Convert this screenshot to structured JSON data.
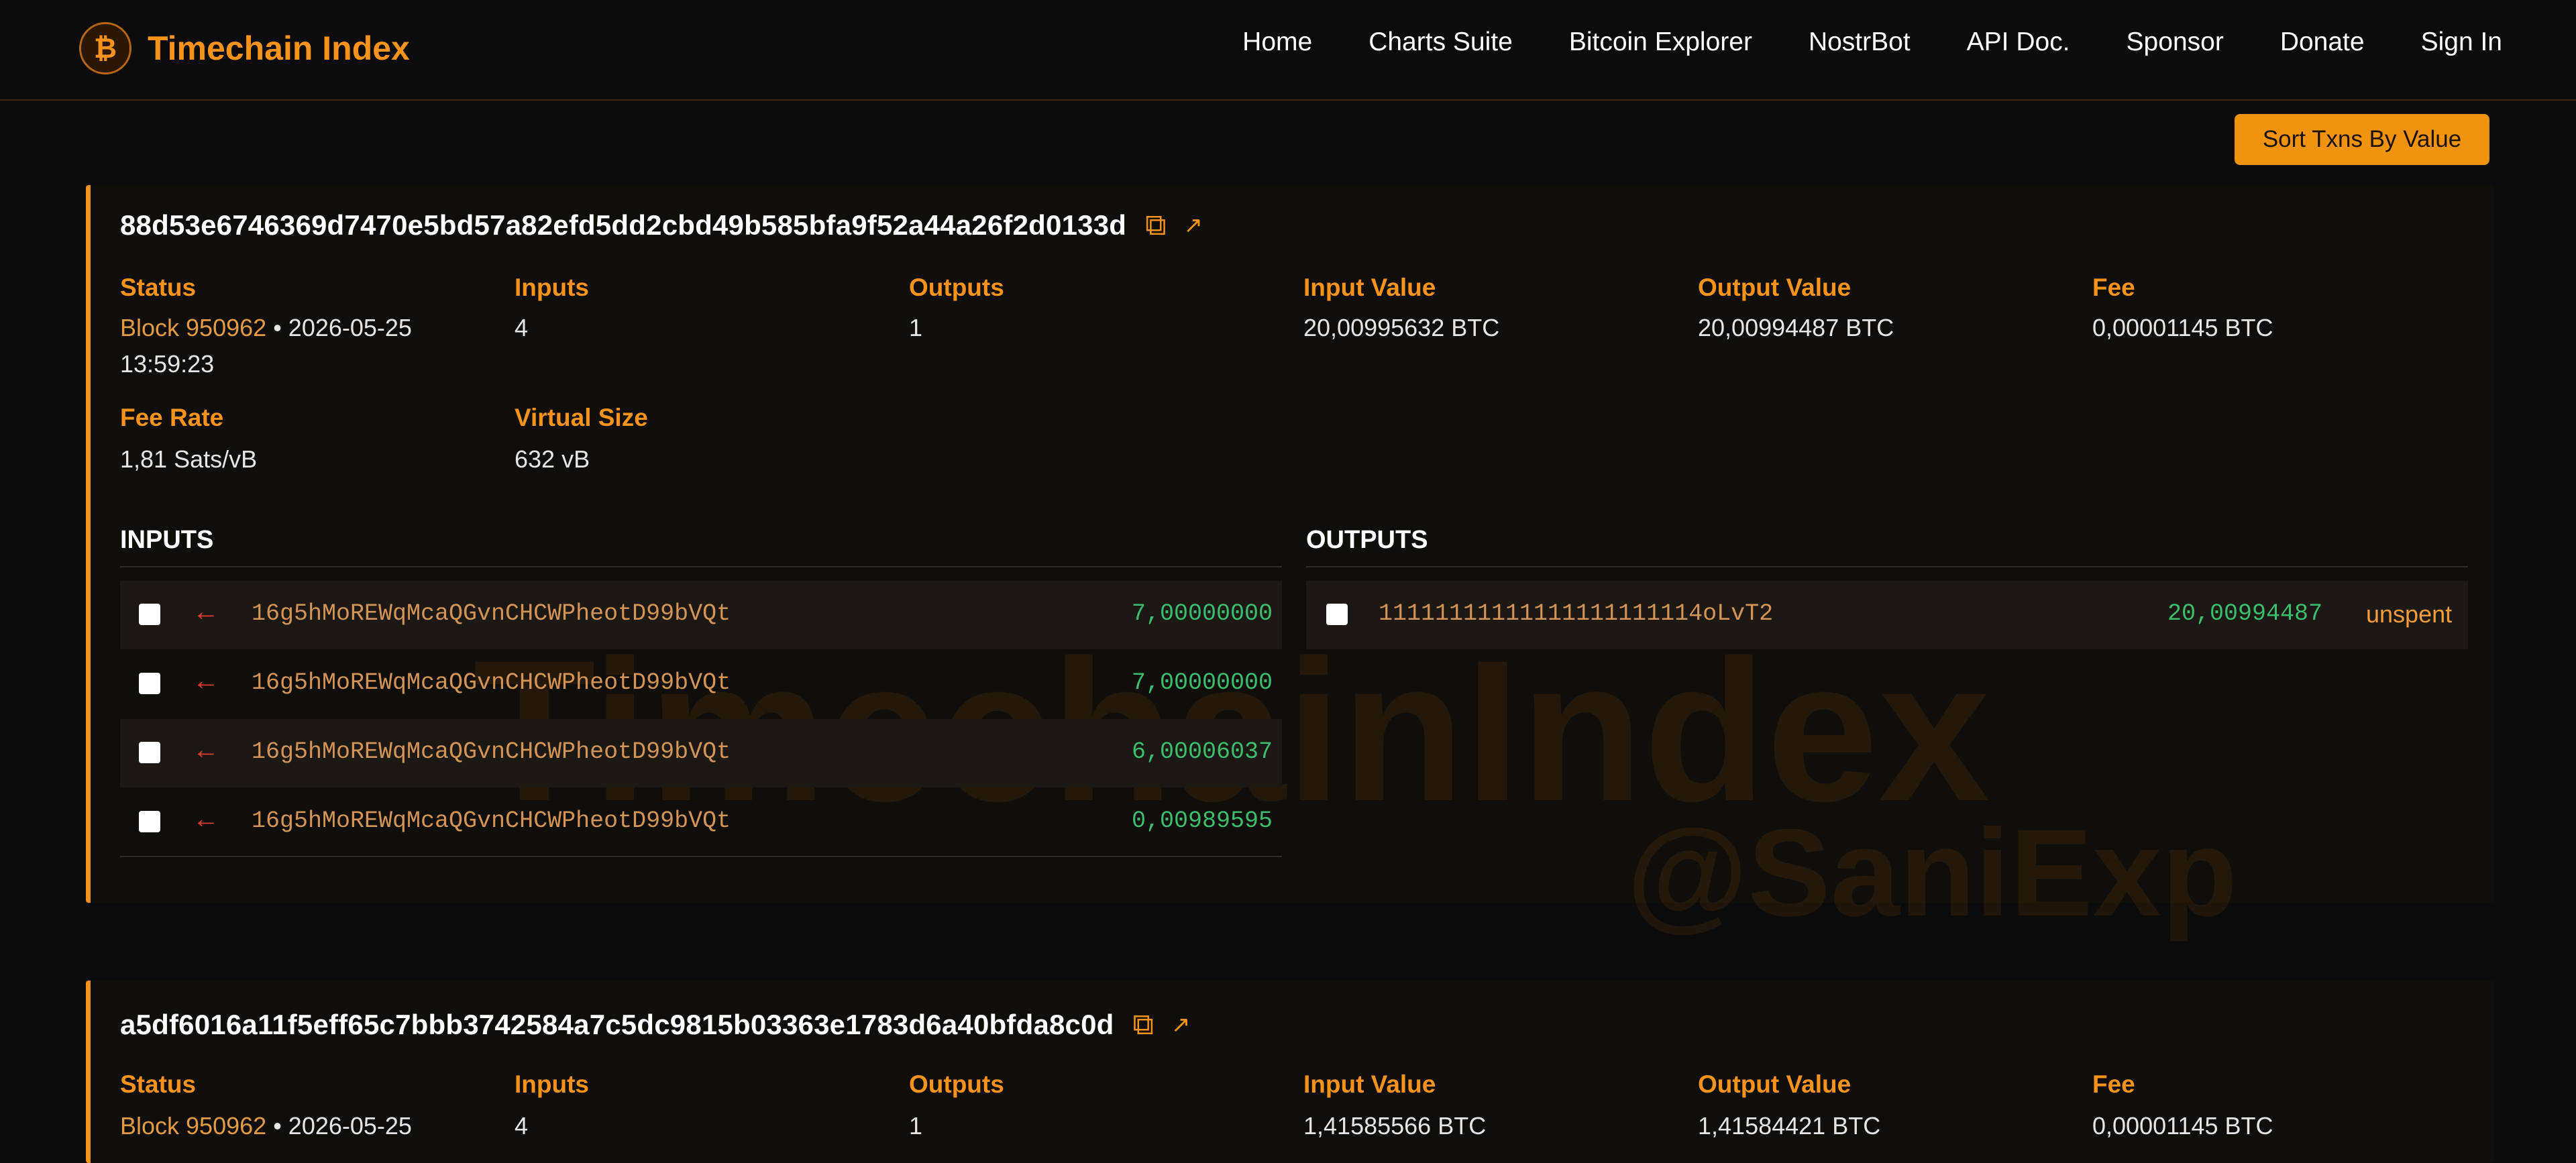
{
  "brand": {
    "logo_symbol": "₿",
    "name": "Timechain Index"
  },
  "nav": [
    "Home",
    "Charts Suite",
    "Bitcoin Explorer",
    "NostrBot",
    "API Doc.",
    "Sponsor",
    "Donate",
    "Sign In"
  ],
  "sort_button": "Sort Txns By Value",
  "watermark": {
    "line1": "TimechainIndex",
    "line2": "@SaniExp"
  },
  "accent_color": "#f7931a",
  "icons": {
    "copy": "copy-icon",
    "external": "external-link-icon",
    "input_arrow": "arrow-left-icon"
  },
  "transactions": [
    {
      "txid": "88d53e6746369d7470e5bd57a82efd5dd2cbd49b585bfa9f52a44a26f2d0133d",
      "labels": {
        "status": "Status",
        "inputs": "Inputs",
        "outputs": "Outputs",
        "input_value": "Input Value",
        "output_value": "Output Value",
        "fee": "Fee",
        "fee_rate": "Fee Rate",
        "virtual_size": "Virtual Size"
      },
      "block": "Block 950962",
      "date": "• 2026-05-25",
      "time": "13:59:23",
      "inputs_count": "4",
      "outputs_count": "1",
      "input_value": "20,00995632 BTC",
      "output_value": "20,00994487 BTC",
      "fee": "0,00001145 BTC",
      "fee_rate": "1,81 Sats/vB",
      "virtual_size": "632 vB",
      "inputs_title": "INPUTS",
      "outputs_title": "OUTPUTS",
      "inputs": [
        {
          "arrow": "←",
          "address": "16g5hMoREWqMcaQGvnCHCWPheotD99bVQt",
          "amount": "7,00000000"
        },
        {
          "arrow": "←",
          "address": "16g5hMoREWqMcaQGvnCHCWPheotD99bVQt",
          "amount": "7,00000000"
        },
        {
          "arrow": "←",
          "address": "16g5hMoREWqMcaQGvnCHCWPheotD99bVQt",
          "amount": "6,00006037"
        },
        {
          "arrow": "←",
          "address": "16g5hMoREWqMcaQGvnCHCWPheotD99bVQt",
          "amount": "0,00989595"
        }
      ],
      "outputs": [
        {
          "address": "11111111111111111111114oLvT2",
          "amount": "20,00994487",
          "status": "unspent"
        }
      ]
    },
    {
      "txid": "a5df6016a11f5eff65c7bbb3742584a7c5dc9815b03363e1783d6a40bfda8c0d",
      "labels": {
        "status": "Status",
        "inputs": "Inputs",
        "outputs": "Outputs",
        "input_value": "Input Value",
        "output_value": "Output Value",
        "fee": "Fee"
      },
      "block": "Block 950962",
      "date": "• 2026-05-25",
      "inputs_count": "4",
      "outputs_count": "1",
      "input_value": "1,41585566 BTC",
      "output_value": "1,41584421 BTC",
      "fee": "0,00001145 BTC"
    }
  ]
}
